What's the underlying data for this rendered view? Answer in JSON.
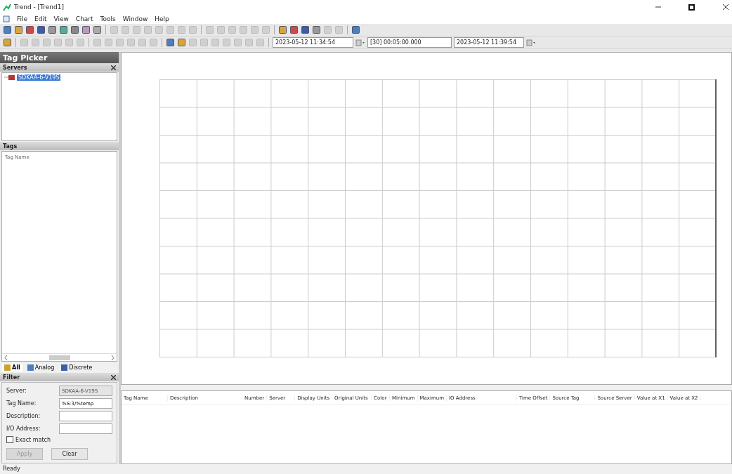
{
  "window": {
    "title": "Trend - [Trend1]"
  },
  "menu": [
    "File",
    "Edit",
    "View",
    "Chart",
    "Tools",
    "Window",
    "Help"
  ],
  "time_bar": {
    "start": "2023-05-12 11:34:54",
    "duration": "[30] 00:05:00.000",
    "end": "2023-05-12 11:39:54"
  },
  "tag_picker": {
    "title": "Tag Picker",
    "servers": {
      "title": "Servers",
      "items": [
        {
          "label": "SDKAA-6-V19S",
          "selected": true
        }
      ]
    },
    "tags": {
      "title": "Tags",
      "column": "Tag Name"
    },
    "tabs": [
      {
        "label": "All",
        "selected": true
      },
      {
        "label": "Analog",
        "selected": false
      },
      {
        "label": "Discrete",
        "selected": false
      }
    ],
    "filter": {
      "title": "Filter",
      "fields": [
        {
          "label": "Server:",
          "value": "SDKAA-6-V19S",
          "disabled": true
        },
        {
          "label": "Tag Name:",
          "value": "%S:3/%temp",
          "disabled": false
        },
        {
          "label": "Description:",
          "disabled": false
        },
        {
          "label": "I/O Address:",
          "disabled": false
        }
      ],
      "exact_match": {
        "label": "Exact match",
        "checked": false
      },
      "buttons": [
        {
          "label": "Apply",
          "disabled": true
        },
        {
          "label": "Clear",
          "disabled": false
        }
      ]
    }
  },
  "tag_table": {
    "columns": [
      "Tag Name",
      "Description",
      "Number",
      "Server",
      "Display Units",
      "Original Units",
      "Color",
      "Minimum",
      "Maximum",
      "IO Address",
      "Time Offset",
      "Source Tag",
      "Source Server",
      "Value at X1",
      "Value at X2"
    ]
  },
  "status_bar": "Ready"
}
